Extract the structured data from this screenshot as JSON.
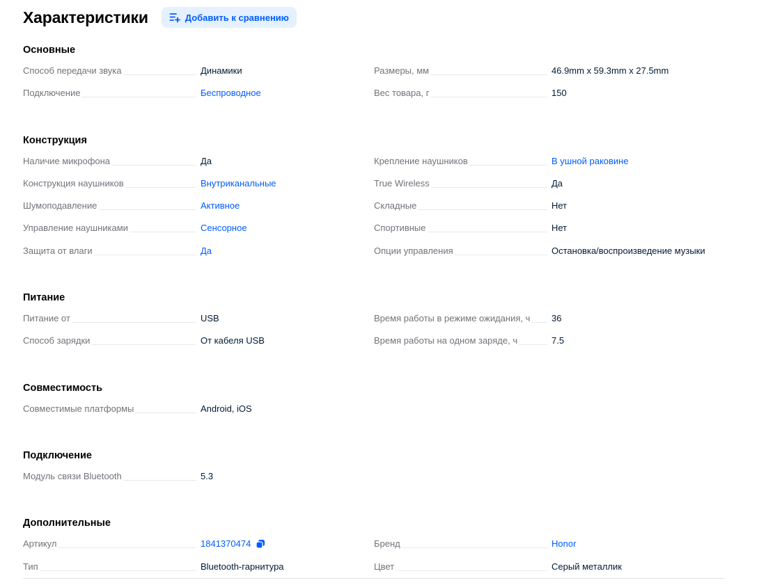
{
  "header": {
    "title": "Характеристики",
    "compare_label": "Добавить к сравнению"
  },
  "colors": {
    "link": "#005bff",
    "button_bg": "#e5f1fe",
    "label": "#70737a",
    "text": "#001a34"
  },
  "sections": [
    {
      "title": "Основные",
      "left": [
        {
          "name": "Способ передачи звука",
          "value": "Динамики",
          "link": false
        },
        {
          "name": "Подключение",
          "value": "Беспроводное",
          "link": true
        }
      ],
      "right": [
        {
          "name": "Размеры, мм",
          "value": "46.9mm x 59.3mm x 27.5mm",
          "link": false
        },
        {
          "name": "Вес товара, г",
          "value": "150",
          "link": false
        }
      ]
    },
    {
      "title": "Конструкция",
      "left": [
        {
          "name": "Наличие микрофона",
          "value": "Да",
          "link": false
        },
        {
          "name": "Конструкция наушников",
          "value": "Внутриканальные",
          "link": true
        },
        {
          "name": "Шумоподавление",
          "value": "Активное",
          "link": true
        },
        {
          "name": "Управление наушниками",
          "value": "Сенсорное",
          "link": true
        },
        {
          "name": "Защита от влаги",
          "value": "Да",
          "link": true
        }
      ],
      "right": [
        {
          "name": "Крепление наушников",
          "value": "В ушной раковине",
          "link": true
        },
        {
          "name": "True Wireless",
          "value": "Да",
          "link": false
        },
        {
          "name": "Складные",
          "value": "Нет",
          "link": false
        },
        {
          "name": "Спортивные",
          "value": "Нет",
          "link": false
        },
        {
          "name": "Опции управления",
          "value": "Остановка/воспроизведение музыки",
          "link": false
        }
      ]
    },
    {
      "title": "Питание",
      "left": [
        {
          "name": "Питание от",
          "value": "USB",
          "link": false
        },
        {
          "name": "Способ зарядки",
          "value": "От кабеля USB",
          "link": false
        }
      ],
      "right": [
        {
          "name": "Время работы в режиме ожидания, ч",
          "value": "36",
          "link": false
        },
        {
          "name": "Время работы на одном заряде, ч",
          "value": "7.5",
          "link": false
        }
      ]
    },
    {
      "title": "Совместимость",
      "left": [
        {
          "name": "Совместимые платформы",
          "value": "Android, iOS",
          "link": false
        }
      ],
      "right": []
    },
    {
      "title": "Подключение",
      "left": [
        {
          "name": "Модуль связи Bluetooth",
          "value": "5.3",
          "link": false
        }
      ],
      "right": []
    },
    {
      "title": "Дополнительные",
      "left": [
        {
          "name": "Артикул",
          "value": "1841370474",
          "link": true,
          "copy": true
        },
        {
          "name": "Тип",
          "value": "Bluetooth-гарнитура",
          "link": false
        }
      ],
      "right": [
        {
          "name": "Бренд",
          "value": "Honor",
          "link": true
        },
        {
          "name": "Цвет",
          "value": "Серый металлик",
          "link": false
        }
      ]
    }
  ]
}
